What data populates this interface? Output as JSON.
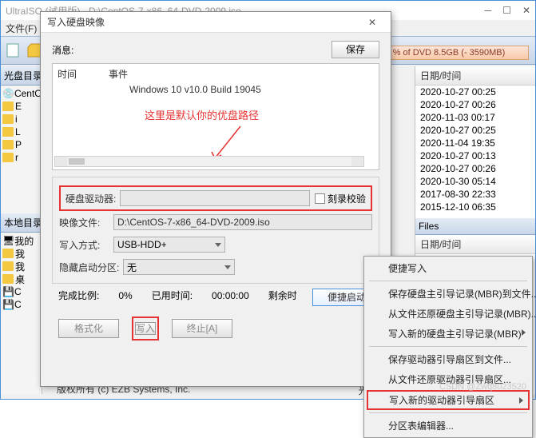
{
  "main": {
    "title": "UltraISO (试用版) - D:\\CentOS-7-x86_64-DVD-2009.iso",
    "menu_file": "文件(F)",
    "capacity": "% of DVD 8.5GB (- 3590MB)",
    "panel_top": "光盘目录",
    "panel_bottom": "本地目录",
    "tree": [
      "CentO",
      "E",
      "i",
      "L",
      "P",
      "r"
    ],
    "tree_bottom": [
      "我的",
      "我",
      "我",
      "桌",
      "C",
      "C"
    ],
    "col_date": "日期/时间",
    "dates": [
      "2020-10-27 00:25",
      "2020-10-27 00:26",
      "2020-11-03 00:17",
      "2020-10-27 00:25",
      "2020-11-04 19:35",
      "2020-10-27 00:13",
      "2020-10-27 00:26",
      "2020-10-30 05:14",
      "2017-08-30 22:33",
      "2015-12-10 06:35"
    ],
    "files_header": "Files",
    "col_date2": "日期/时间",
    "copyright": "版权所有 (c) EZB Systems, Inc.",
    "statusbar": "光盘目录: 8",
    "watermark": "CSDN @Zwq8023520"
  },
  "dialog": {
    "title": "写入硬盘映像",
    "msg_label": "消息:",
    "save_btn": "保存",
    "col_time": "时间",
    "col_event": "事件",
    "event_line": "Windows 10 v10.0 Build 19045",
    "red_note": "这里是默认你的优盘路径",
    "drive_label": "硬盘驱动器:",
    "verify_label": "刻录校验",
    "image_label": "映像文件:",
    "image_path": "D:\\CentOS-7-x86_64-DVD-2009.iso",
    "method_label": "写入方式:",
    "method_value": "USB-HDD+",
    "hidden_label": "隐藏启动分区:",
    "hidden_value": "无",
    "boot_btn": "便捷启动",
    "progress_label": "完成比例:",
    "progress_value": "0%",
    "elapsed_label": "已用时间:",
    "elapsed_value": "00:00:00",
    "remain_label": "剩余时",
    "btn_format": "格式化",
    "btn_write": "写入",
    "btn_abort": "终止[A]"
  },
  "menu": {
    "items": [
      "便捷写入",
      "保存硬盘主引导记录(MBR)到文件...",
      "从文件还原硬盘主引导记录(MBR)...",
      "写入新的硬盘主引导记录(MBR)",
      "保存驱动器引导扇区到文件...",
      "从文件还原驱动器引导扇区...",
      "写入新的驱动器引导扇区",
      "分区表编辑器..."
    ]
  }
}
